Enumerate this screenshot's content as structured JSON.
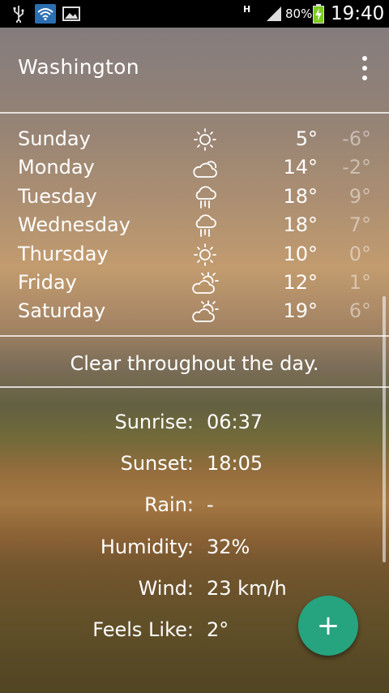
{
  "status_bar": {
    "network_type": "H",
    "battery_percent": "80%",
    "time": "19:40"
  },
  "header": {
    "city": "Washington"
  },
  "forecast": [
    {
      "day": "Sunday",
      "icon": "sun-icon",
      "high": "5°",
      "low": "-6°"
    },
    {
      "day": "Monday",
      "icon": "cloud-sun-icon",
      "high": "14°",
      "low": "-2°"
    },
    {
      "day": "Tuesday",
      "icon": "rain-icon",
      "high": "18°",
      "low": "9°"
    },
    {
      "day": "Wednesday",
      "icon": "rain-icon",
      "high": "18°",
      "low": "7°"
    },
    {
      "day": "Thursday",
      "icon": "sun-icon",
      "high": "10°",
      "low": "0°"
    },
    {
      "day": "Friday",
      "icon": "partly-cloudy-icon",
      "high": "12°",
      "low": "1°"
    },
    {
      "day": "Saturday",
      "icon": "partly-cloudy-icon",
      "high": "19°",
      "low": "6°"
    }
  ],
  "summary": "Clear throughout the day.",
  "details": [
    {
      "label": "Sunrise:",
      "value": "06:37"
    },
    {
      "label": "Sunset:",
      "value": "18:05"
    },
    {
      "label": "Rain:",
      "value": "-"
    },
    {
      "label": "Humidity:",
      "value": "32%"
    },
    {
      "label": "Wind:",
      "value": "23 km/h"
    },
    {
      "label": "Feels Like:",
      "value": "2°"
    }
  ],
  "fab": {
    "label": "+"
  },
  "colors": {
    "accent": "#26a37f",
    "status_bar": "#000000",
    "battery": "#7ccd1f"
  }
}
